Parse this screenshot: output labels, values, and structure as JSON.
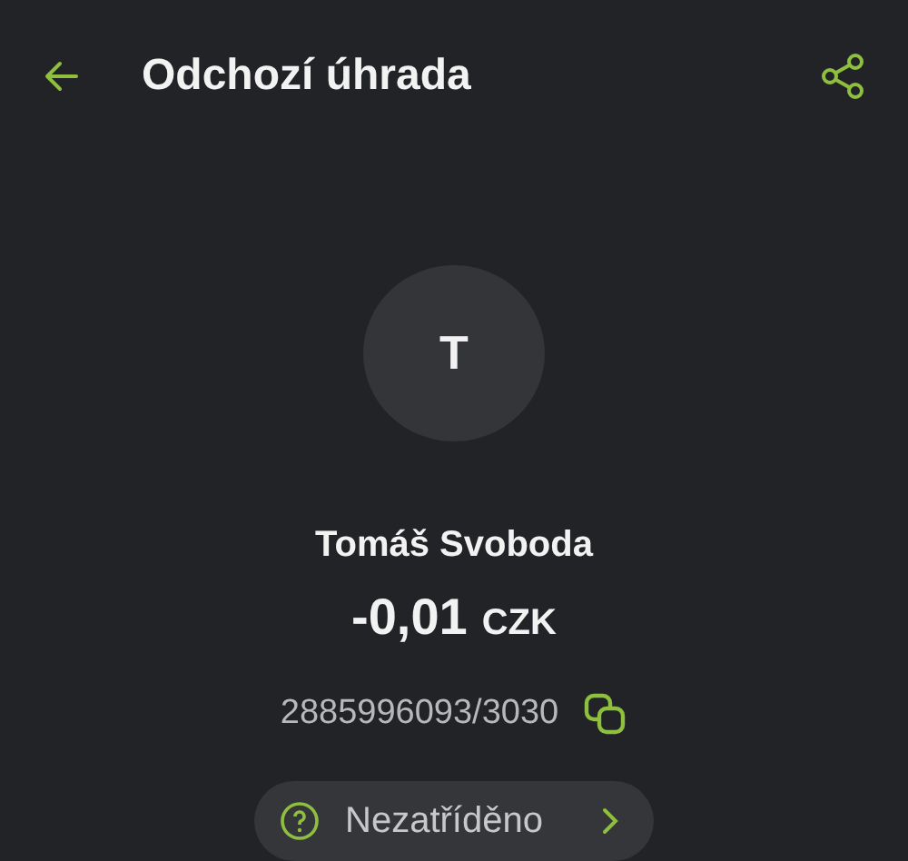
{
  "header": {
    "title": "Odchozí úhrada"
  },
  "avatar": {
    "initial": "T"
  },
  "counterparty": {
    "name": "Tomáš Svoboda",
    "amount": "-0,01",
    "currency": "CZK",
    "account": "2885996093/3030"
  },
  "category": {
    "label": "Nezatříděno"
  }
}
